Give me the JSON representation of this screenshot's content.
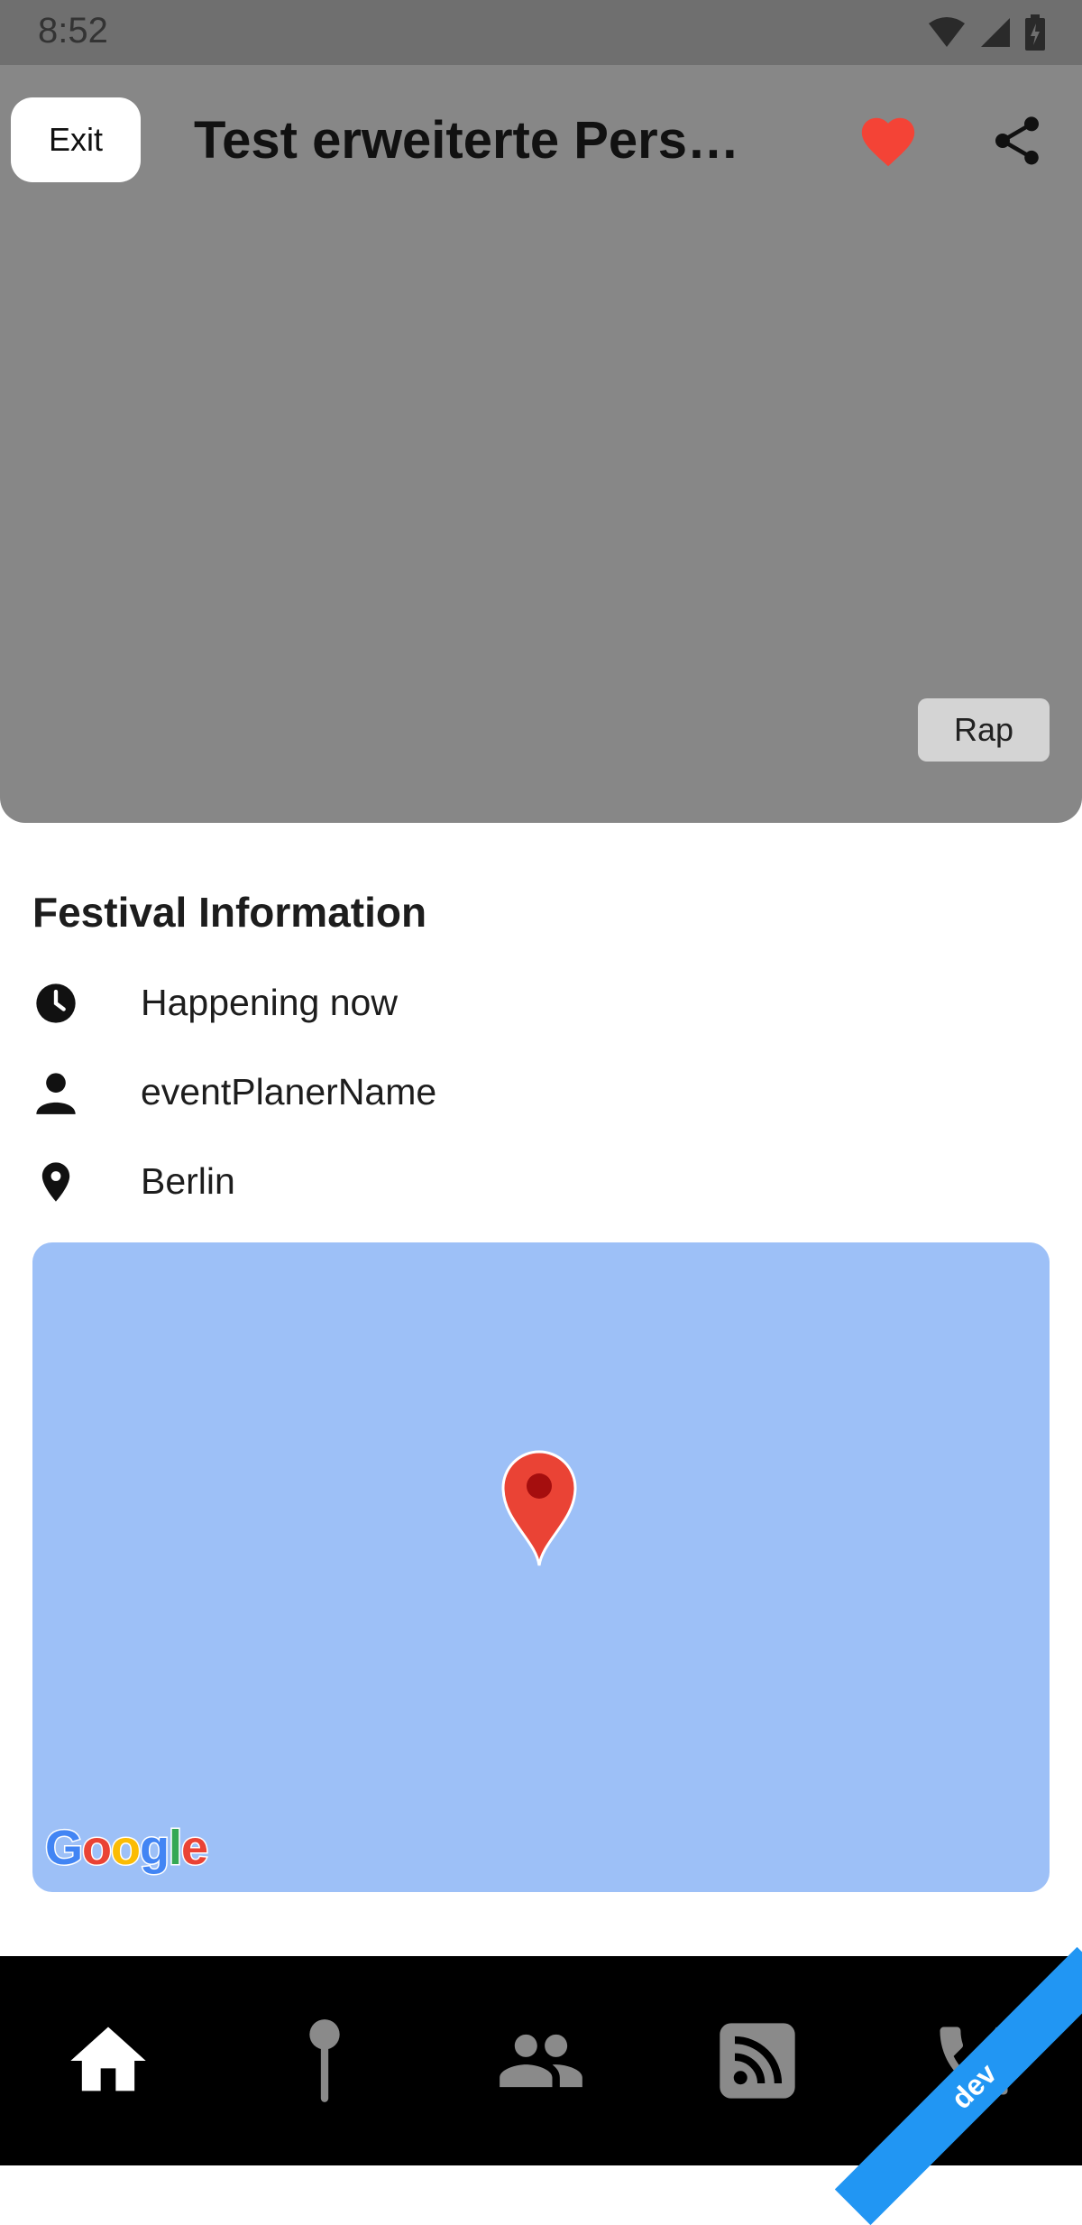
{
  "status_bar": {
    "time": "8:52"
  },
  "header": {
    "exit_label": "Exit",
    "title": "Test erweiterte Perso…",
    "favorite_color": "#f44336"
  },
  "hero": {
    "tag_label": "Rap"
  },
  "info": {
    "section_title": "Festival Information",
    "time_status": "Happening now",
    "organizer": "eventPlanerName",
    "location": "Berlin"
  },
  "map": {
    "logo_letters": [
      "G",
      "o",
      "o",
      "g",
      "l",
      "e"
    ],
    "logo_colors": [
      "#4285F4",
      "#EA4335",
      "#FBBC05",
      "#4285F4",
      "#34A853",
      "#EA4335"
    ],
    "background_color": "#9dc0f7",
    "pin_color": "#ea4335"
  },
  "bottom_nav": {
    "items": [
      {
        "icon": "home-icon",
        "active": true
      },
      {
        "icon": "pin-icon",
        "active": false
      },
      {
        "icon": "group-icon",
        "active": false
      },
      {
        "icon": "rss-feed-icon",
        "active": false
      },
      {
        "icon": "phone-emergency-icon",
        "active": false
      }
    ],
    "ribbon_label": "dev"
  }
}
